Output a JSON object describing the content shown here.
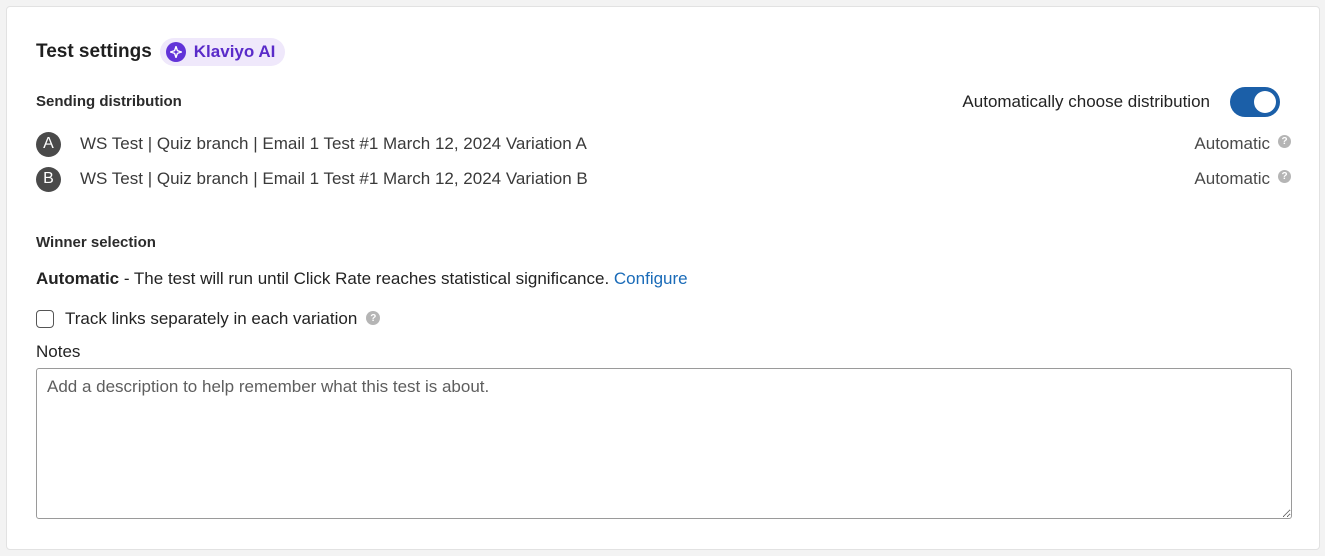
{
  "header": {
    "title": "Test settings",
    "ai_badge_label": "Klaviyo AI",
    "ai_badge_color": "#6233d8"
  },
  "distribution": {
    "section_label": "Sending distribution",
    "auto_toggle_label": "Automatically choose distribution",
    "auto_toggle_on": true,
    "toggle_color": "#1b5fa8",
    "variations": [
      {
        "letter": "A",
        "name": "WS Test | Quiz branch | Email 1 Test #1 March 12, 2024 Variation A",
        "allocation": "Automatic"
      },
      {
        "letter": "B",
        "name": "WS Test | Quiz branch | Email 1 Test #1 March 12, 2024 Variation B",
        "allocation": "Automatic"
      }
    ]
  },
  "winner": {
    "section_label": "Winner selection",
    "mode": "Automatic",
    "description": " - The test will run until Click Rate reaches statistical significance. ",
    "configure_link": "Configure",
    "link_color": "#1a6bb8"
  },
  "tracking": {
    "checkbox_label": "Track links separately in each variation",
    "checked": false
  },
  "notes": {
    "label": "Notes",
    "placeholder": "Add a description to help remember what this test is about.",
    "value": ""
  }
}
